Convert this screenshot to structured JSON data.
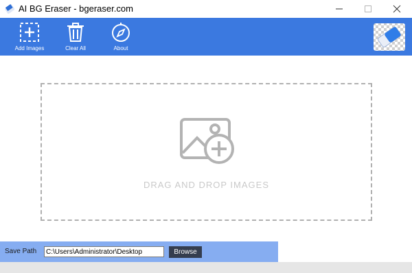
{
  "window": {
    "title": "AI BG Eraser - bgeraser.com",
    "controls": {
      "minimize_icon": "minimize-icon",
      "maximize_icon": "maximize-icon",
      "close_icon": "close-icon"
    }
  },
  "toolbar": {
    "add_images_label": "Add Images",
    "clear_all_label": "Clear All",
    "about_label": "About",
    "icons": {
      "add_images": "dashed-plus-icon",
      "clear_all": "trash-icon",
      "about": "compass-icon",
      "logo": "eraser-logo-icon"
    }
  },
  "dropzone": {
    "text": "DRAG AND DROP IMAGES",
    "icon": "image-add-icon"
  },
  "save": {
    "label": "Save Path",
    "path": "C:\\Users\\Administrator\\Desktop",
    "browse_label": "Browse"
  },
  "colors": {
    "toolbar": "#3b79e0",
    "savebar": "#86adf1",
    "browse_button": "#343d4e",
    "dropzone_border": "#b0b0b0"
  }
}
